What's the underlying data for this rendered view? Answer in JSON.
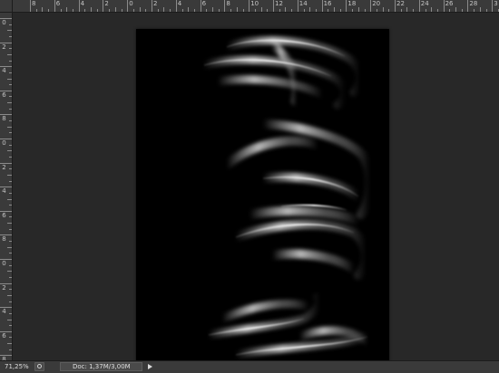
{
  "ruler": {
    "top_labels": [
      "8",
      "6",
      "4",
      "2",
      "0",
      "2",
      "4",
      "6",
      "8",
      "10",
      "12",
      "14",
      "16",
      "18",
      "20",
      "22",
      "24",
      "26",
      "28",
      "3"
    ],
    "left_labels": [
      "0",
      "2",
      "4",
      "6",
      "8",
      "0",
      "2",
      "4",
      "6",
      "8",
      "0",
      "2",
      "4",
      "6",
      "8"
    ],
    "unit": "cm"
  },
  "status": {
    "zoom": "71,25%",
    "doc_info": "Doc: 1,37M/3,00M"
  },
  "icons": {
    "status_icon": "proof-setup-icon",
    "menu_arrow": "play-triangle-icon"
  },
  "colors": {
    "ruler_bg": "#3a3a3a",
    "workspace_bg": "#282828",
    "canvas_bg": "#000000",
    "artwork_highlight": "#e6e6e6"
  }
}
